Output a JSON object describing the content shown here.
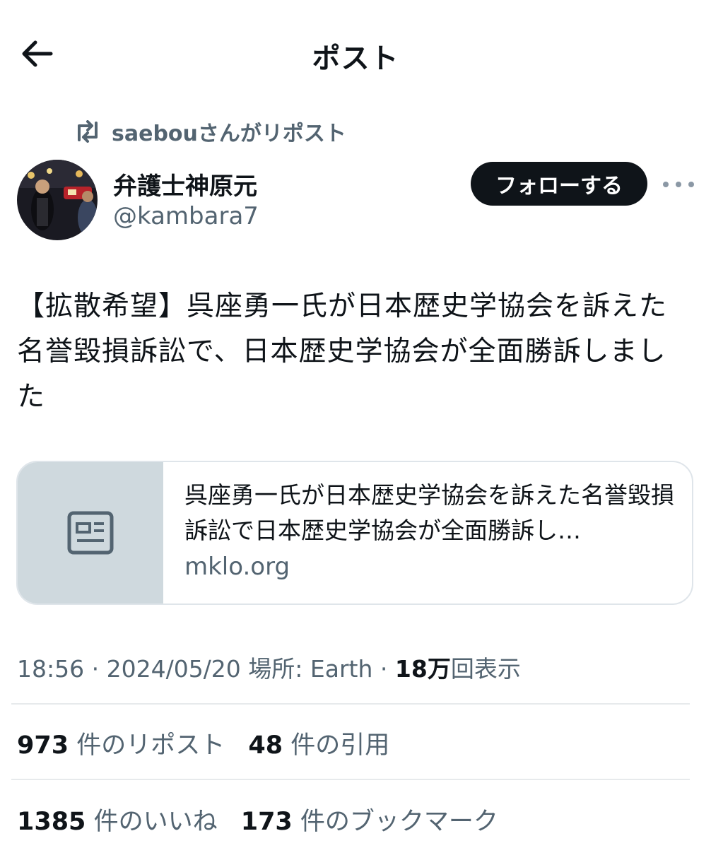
{
  "header": {
    "title": "ポスト",
    "back_icon": "arrow-left-icon"
  },
  "repost_banner": {
    "text": "saebouさんがリポスト",
    "icon": "repost-icon"
  },
  "author": {
    "display_name": "弁護士神原元",
    "handle": "@kambara7",
    "follow_label": "フォローする",
    "more_icon": "more-horizontal-icon"
  },
  "post": {
    "text": "【拡散希望】呉座勇一氏が日本歴史学協会を訴えた名誉毀損訴訟で、日本歴史学協会が全面勝訴しました"
  },
  "link_card": {
    "title": "呉座勇一氏が日本歴史学協会を訴えた名誉毀損訴訟で日本歴史学協会が全面勝訴し…",
    "domain": "mklo.org",
    "icon": "article-icon"
  },
  "meta": {
    "time": "18:56",
    "date": "2024/05/20",
    "location_label": "場所:",
    "location": "Earth",
    "views_count": "18万",
    "views_label": "回表示"
  },
  "stats": {
    "reposts_count": "973",
    "reposts_label": "件のリポスト",
    "quotes_count": "48",
    "quotes_label": "件の引用",
    "likes_count": "1385",
    "likes_label": "件のいいね",
    "bookmarks_count": "173",
    "bookmarks_label": "件のブックマーク"
  },
  "colors": {
    "text_primary": "#0f1419",
    "text_secondary": "#536471",
    "follow_bg": "#0f1419",
    "card_thumb_bg": "#cfd9de",
    "border": "#dfe5ea"
  }
}
